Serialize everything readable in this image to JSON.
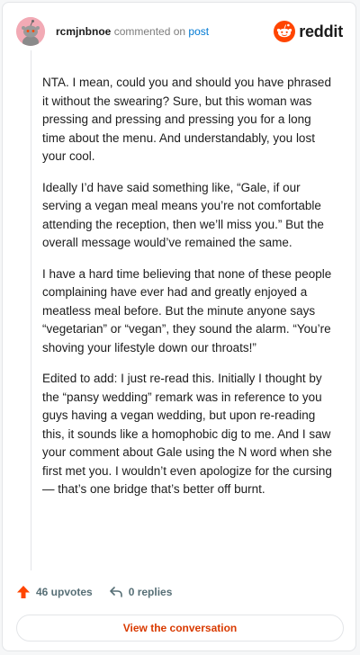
{
  "header": {
    "username": "rcmjnbnoe",
    "action_text": "commented on",
    "post_link": "post",
    "brand_name": "reddit"
  },
  "comment": {
    "paragraphs": [
      "NTA. I mean, could you and should you have phrased it without the swearing? Sure, but this woman was pressing and pressing and pressing you for a long time about the menu. And understandably, you lost your cool.",
      "Ideally I’d have said something like, “Gale, if our serving a vegan meal means you’re not comfortable attending the reception, then we’ll miss you.” But the overall message would’ve remained the same.",
      "I have a hard time believing that none of these people complaining have ever had and greatly enjoyed a meatless meal before. But the minute anyone says “vegetarian” or “vegan”, they sound the alarm. “You’re shoving your lifestyle down our throats!”",
      "Edited to add: I just re-read this. Initially I thought by the “pansy wedding” remark was in reference to you guys having a vegan wedding, but upon re-reading this, it sounds like a homophobic dig to me. And I saw your comment about Gale using the N word when she first met you. I wouldn’t even apologize for the cursing— that’s one bridge that’s better off burnt."
    ]
  },
  "actions": {
    "upvotes_label": "46 upvotes",
    "replies_label": "0 replies"
  },
  "cta": {
    "label": "View the conversation"
  },
  "icons": {
    "avatar": "snoo-avatar-icon",
    "brand": "reddit-logo-icon",
    "upvote": "upvote-arrow-icon",
    "reply": "reply-arrow-icon"
  },
  "colors": {
    "brand_orange": "#ff4500",
    "upvote_orange": "#ff4500",
    "link_blue": "#0079d3",
    "cta_text": "#d93a00",
    "avatar_bg": "#f2aab5"
  }
}
